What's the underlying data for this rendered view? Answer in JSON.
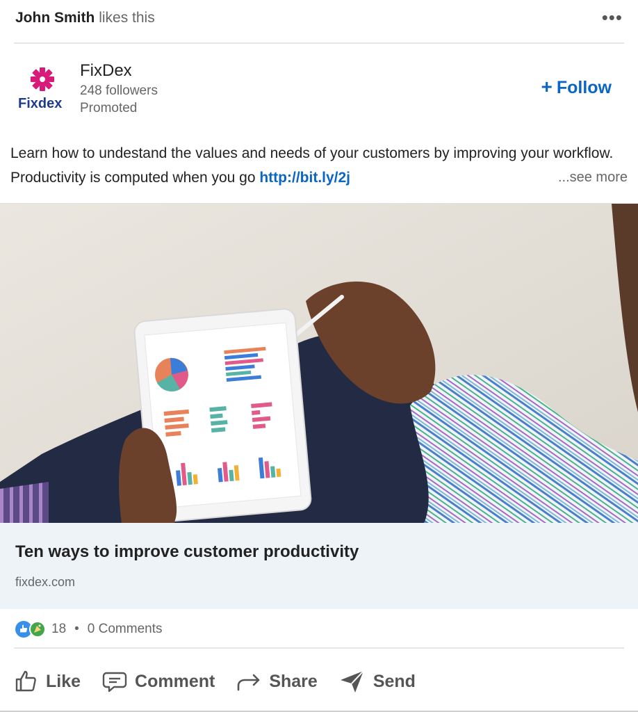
{
  "header": {
    "actor": "John Smith",
    "action_text": "likes this",
    "more_label": "•••"
  },
  "company": {
    "logo_text": "Fixdex",
    "name": "FixDex",
    "followers": "248 followers",
    "promoted": "Promoted",
    "follow_label": "Follow",
    "follow_plus": "+"
  },
  "post": {
    "text_before": "Learn how to undestand the values and needs of your customers by improving your workflow. Productivity is computed when you go ",
    "link": "http://bit.ly/2j",
    "see_more": "...see more"
  },
  "hero": {
    "image_subject": "tablet-with-charts-photo"
  },
  "article": {
    "title": "Ten ways to improve customer productivity",
    "domain": "fixdex.com"
  },
  "social_counts": {
    "reactions": "18",
    "separator": "•",
    "comments": "0 Comments"
  },
  "actions": [
    {
      "label": "Like",
      "icon": "like-icon"
    },
    {
      "label": "Comment",
      "icon": "comment-icon"
    },
    {
      "label": "Share",
      "icon": "share-icon"
    },
    {
      "label": "Send",
      "icon": "send-icon"
    }
  ],
  "colors": {
    "link_blue": "#0a66c2",
    "logo_pink": "#d81b7a",
    "logo_navy": "#1f3b8c",
    "article_bg": "#eef3f8"
  }
}
